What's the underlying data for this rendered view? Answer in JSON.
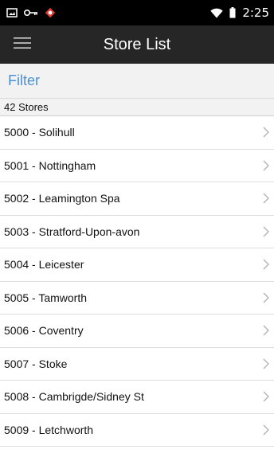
{
  "status_bar": {
    "time": "2:25",
    "left_icons": [
      "screenshot-icon",
      "key-icon",
      "app-notification-icon"
    ],
    "right_icons": [
      "wifi-icon",
      "battery-icon"
    ]
  },
  "app_bar": {
    "title": "Store List",
    "menu_icon": "hamburger-menu-icon"
  },
  "filter": {
    "label": "Filter"
  },
  "list": {
    "count_label": "42 Stores",
    "items": [
      {
        "label": "5000 - Solihull"
      },
      {
        "label": "5001 - Nottingham"
      },
      {
        "label": "5002 - Leamington Spa"
      },
      {
        "label": "5003 - Stratford-Upon-avon"
      },
      {
        "label": "5004 - Leicester"
      },
      {
        "label": "5005 - Tamworth"
      },
      {
        "label": "5006 - Coventry"
      },
      {
        "label": "5007 - Stoke"
      },
      {
        "label": "5008 - Cambrigde/Sidney St"
      },
      {
        "label": "5009 - Letchworth"
      }
    ],
    "row_icon": "chevron-right-icon"
  },
  "colors": {
    "status_bar_bg": "#000000",
    "app_bar_bg": "#262626",
    "filter_bg": "#f2f2f2",
    "filter_text": "#4a90d9",
    "divider": "#dcdcdc",
    "chevron": "#b0b0b0"
  }
}
